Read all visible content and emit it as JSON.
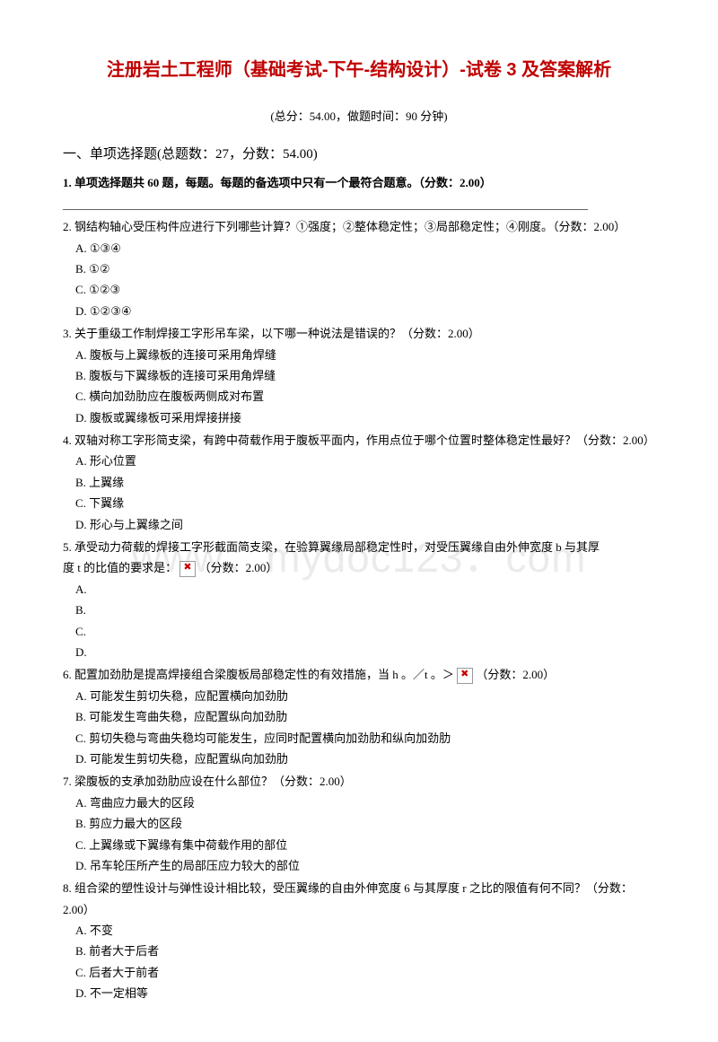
{
  "title": "注册岩土工程师（基础考试-下午-结构设计）-试卷 3 及答案解析",
  "meta": "(总分：54.00，做题时间：90 分钟)",
  "section_head": "一、单项选择题(总题数：27，分数：54.00)",
  "watermark": "www．mydoc123．com",
  "q1": {
    "stem": "1. 单项选择题共 60 题，每题。每题的备选项中只有一个最符合题意。（分数：2.00）",
    "line2": "__________________________________________________________________________________________"
  },
  "q2": {
    "stem": "2. 钢结构轴心受压构件应进行下列哪些计算？①强度；②整体稳定性；③局部稳定性；④刚度。（分数：2.00）",
    "a": "A. ①③④",
    "b": "B. ①②",
    "c": "C. ①②③",
    "d": "D. ①②③④"
  },
  "q3": {
    "stem": "3. 关于重级工作制焊接工字形吊车梁，以下哪一种说法是错误的？（分数：2.00）",
    "a": "A. 腹板与上翼缘板的连接可采用角焊缝",
    "b": "B. 腹板与下翼缘板的连接可采用角焊缝",
    "c": "C. 横向加劲肋应在腹板两侧成对布置",
    "d": "D. 腹板或翼缘板可采用焊接拼接"
  },
  "q4": {
    "stem": "4. 双轴对称工字形简支梁，有跨中荷载作用于腹板平面内，作用点位于哪个位置时整体稳定性最好？（分数：2.00）",
    "a": "A. 形心位置",
    "b": "B. 上翼缘",
    "c": "C. 下翼缘",
    "d": "D. 形心与上翼缘之间"
  },
  "q5": {
    "stem_pre": "5. 承受动力荷载的焊接工字形截面简支梁，在验算翼缘局部稳定性时，对受压翼缘自由外伸宽度 b 与其厚",
    "stem_mid": "度 t 的比值的要求是：",
    "stem_post": "（分数：2.00）",
    "a": "A.",
    "b": "B.",
    "c": "C.",
    "d": "D."
  },
  "q6": {
    "stem_pre": "6. 配置加劲肋是提高焊接组合梁腹板局部稳定性的有效措施，当 h 。／t 。＞",
    "stem_post": "（分数：2.00）",
    "a": "A. 可能发生剪切失稳，应配置横向加劲肋",
    "b": "B. 可能发生弯曲失稳，应配置纵向加劲肋",
    "c": "C. 剪切失稳与弯曲失稳均可能发生，应同时配置横向加劲肋和纵向加劲肋",
    "d": "D. 可能发生剪切失稳，应配置纵向加劲肋"
  },
  "q7": {
    "stem": "7. 梁腹板的支承加劲肋应设在什么部位？（分数：2.00）",
    "a": "A. 弯曲应力最大的区段",
    "b": "B. 剪应力最大的区段",
    "c": "C. 上翼缘或下翼缘有集中荷载作用的部位",
    "d": "D. 吊车轮压所产生的局部压应力较大的部位"
  },
  "q8": {
    "stem": "8. 组合梁的塑性设计与弹性设计相比较，受压翼缘的自由外伸宽度 6 与其厚度 r 之比的限值有何不同？（分数：2.00）",
    "a": "A. 不变",
    "b": "B. 前者大于后者",
    "c": "C. 后者大于前者",
    "d": "D. 不一定相等"
  }
}
